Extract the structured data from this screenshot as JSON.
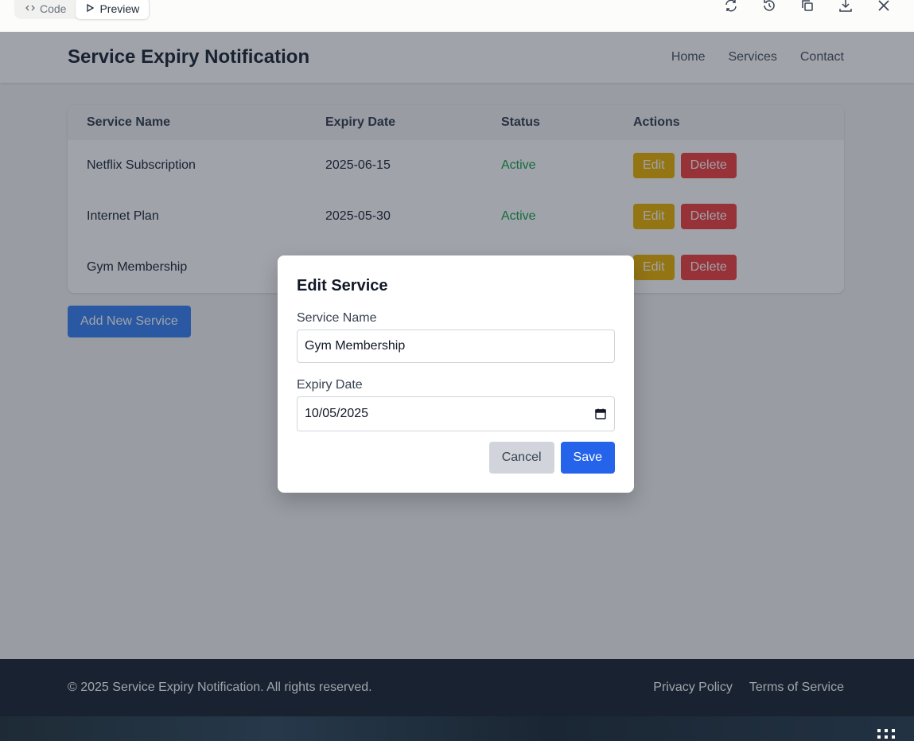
{
  "toolbar": {
    "tab_code": "Code",
    "tab_preview": "Preview"
  },
  "app": {
    "brand": "Service Expiry Notification",
    "nav": [
      "Home",
      "Services",
      "Contact"
    ]
  },
  "table": {
    "headers": [
      "Service Name",
      "Expiry Date",
      "Status",
      "Actions"
    ],
    "rows": [
      {
        "name": "Netflix Subscription",
        "date": "2025-06-15",
        "status": "Active"
      },
      {
        "name": "Internet Plan",
        "date": "2025-05-30",
        "status": "Active"
      },
      {
        "name": "Gym Membership",
        "date": "",
        "status": ""
      }
    ],
    "edit_label": "Edit",
    "delete_label": "Delete"
  },
  "add_button": "Add New Service",
  "modal": {
    "title": "Edit Service",
    "name_label": "Service Name",
    "name_value": "Gym Membership",
    "date_label": "Expiry Date",
    "date_value": "10/05/2025",
    "cancel": "Cancel",
    "save": "Save"
  },
  "footer": {
    "copyright": "© 2025 Service Expiry Notification. All rights reserved.",
    "links": [
      "Privacy Policy",
      "Terms of Service"
    ]
  },
  "colors": {
    "primary": "#2563eb",
    "edit": "#eab308",
    "delete": "#ef4444",
    "active": "#16a34a"
  }
}
